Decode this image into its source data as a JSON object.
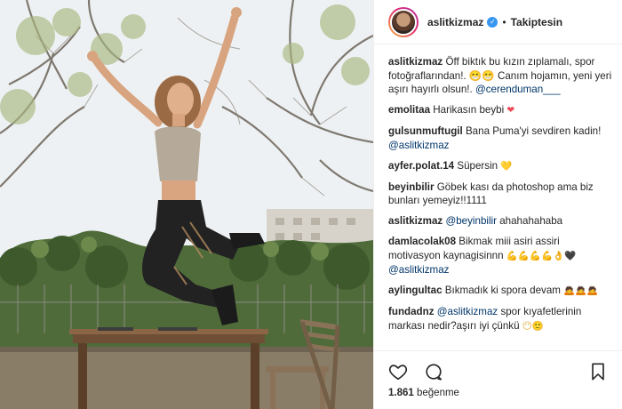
{
  "post": {
    "username": "aslitkizmaz",
    "verified_mark": "✓",
    "separator": "•",
    "follow_label": "Takiptesin",
    "likes_count": "1.861",
    "likes_label": "beğenme"
  },
  "comments": [
    {
      "user": "aslitkizmaz",
      "text": "Öff biktık bu kızın zıplamalı, spor fotoğraflarından!. 😁😁 Canım hojamın, yeni yeri aşırı hayırlı olsun!. ",
      "mention": "@cerenduman___"
    },
    {
      "user": "emolitaa",
      "text": "Harikasın beybi ",
      "emoji": "❤"
    },
    {
      "user": "gulsunmuftugil",
      "text": "Bana Puma'yi sevdiren kadin! ",
      "mention": "@aslitkizmaz"
    },
    {
      "user": "ayfer.polat.14",
      "text": "Süpersin ",
      "emoji": "💛"
    },
    {
      "user": "beyinbilir",
      "text": "Göbek kası da photoshop ama biz bunları yemeyiz!!1111"
    },
    {
      "user": "aslitkizmaz",
      "mention_first": "@beyinbilir",
      "text": " ahahahahaba"
    },
    {
      "user": "damlacolak08",
      "text": "Bikmak miii asiri assiri motivasyon kaynagisinnn ",
      "emoji": "💪💪💪💪👌🖤 ",
      "mention": "@aslitkizmaz"
    },
    {
      "user": "aylingultac",
      "text": "Bıkmadık ki spora devam ",
      "emoji": "🙇🙇🙇"
    },
    {
      "user": "fundadnz",
      "mention_first": "@aslitkizmaz",
      "text": " spor kıyafetlerinin markası nedir?aşırı iyi çünkü ",
      "emoji": "😶🙂"
    }
  ],
  "icons": {
    "like": "heart-icon",
    "comment": "comment-bubble-icon",
    "save": "bookmark-icon"
  },
  "colors": {
    "verified": "#3897f0",
    "mention": "#003569",
    "text": "#262626",
    "border": "#efefef"
  }
}
